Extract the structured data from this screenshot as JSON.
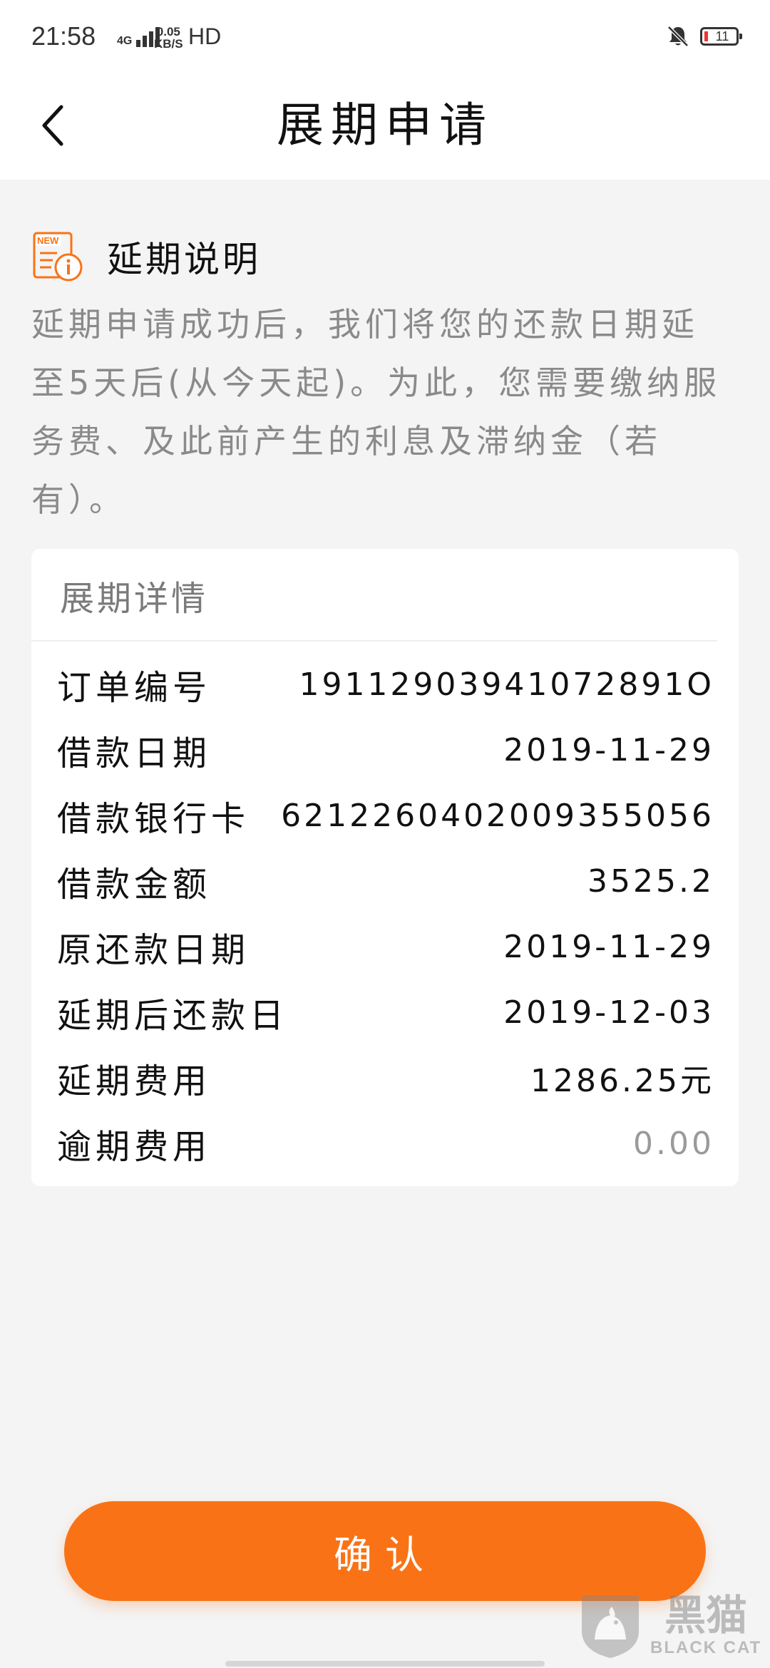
{
  "status_bar": {
    "time": "21:58",
    "network": "4G",
    "speed_value": "0.05",
    "speed_unit": "KB/S",
    "hd": "HD",
    "battery_level": "11"
  },
  "header": {
    "title": "展期申请"
  },
  "notice": {
    "title": "延期说明",
    "body": "延期申请成功后，我们将您的还款日期延至5天后(从今天起)。为此，您需要缴纳服务费、及此前产生的利息及滞纳金（若有）。"
  },
  "details": {
    "title": "展期详情",
    "rows": [
      {
        "label": "订单编号",
        "value": "19112903941072891O"
      },
      {
        "label": "借款日期",
        "value": "2019-11-29"
      },
      {
        "label": "借款银行卡",
        "value": "6212260402009355056"
      },
      {
        "label": "借款金额",
        "value": "3525.2"
      },
      {
        "label": "原还款日期",
        "value": "2019-11-29"
      },
      {
        "label": "延期后还款日",
        "value": "2019-12-03"
      },
      {
        "label": "延期费用",
        "value": "1286.25元"
      },
      {
        "label": "逾期费用",
        "value": "0.00"
      }
    ]
  },
  "confirm": {
    "label": "确认"
  },
  "watermark": {
    "cn": "黑猫",
    "en": "BLACK CAT"
  },
  "colors": {
    "accent": "#f97316",
    "background": "#f4f4f4",
    "muted_text": "#8a8a8a"
  }
}
